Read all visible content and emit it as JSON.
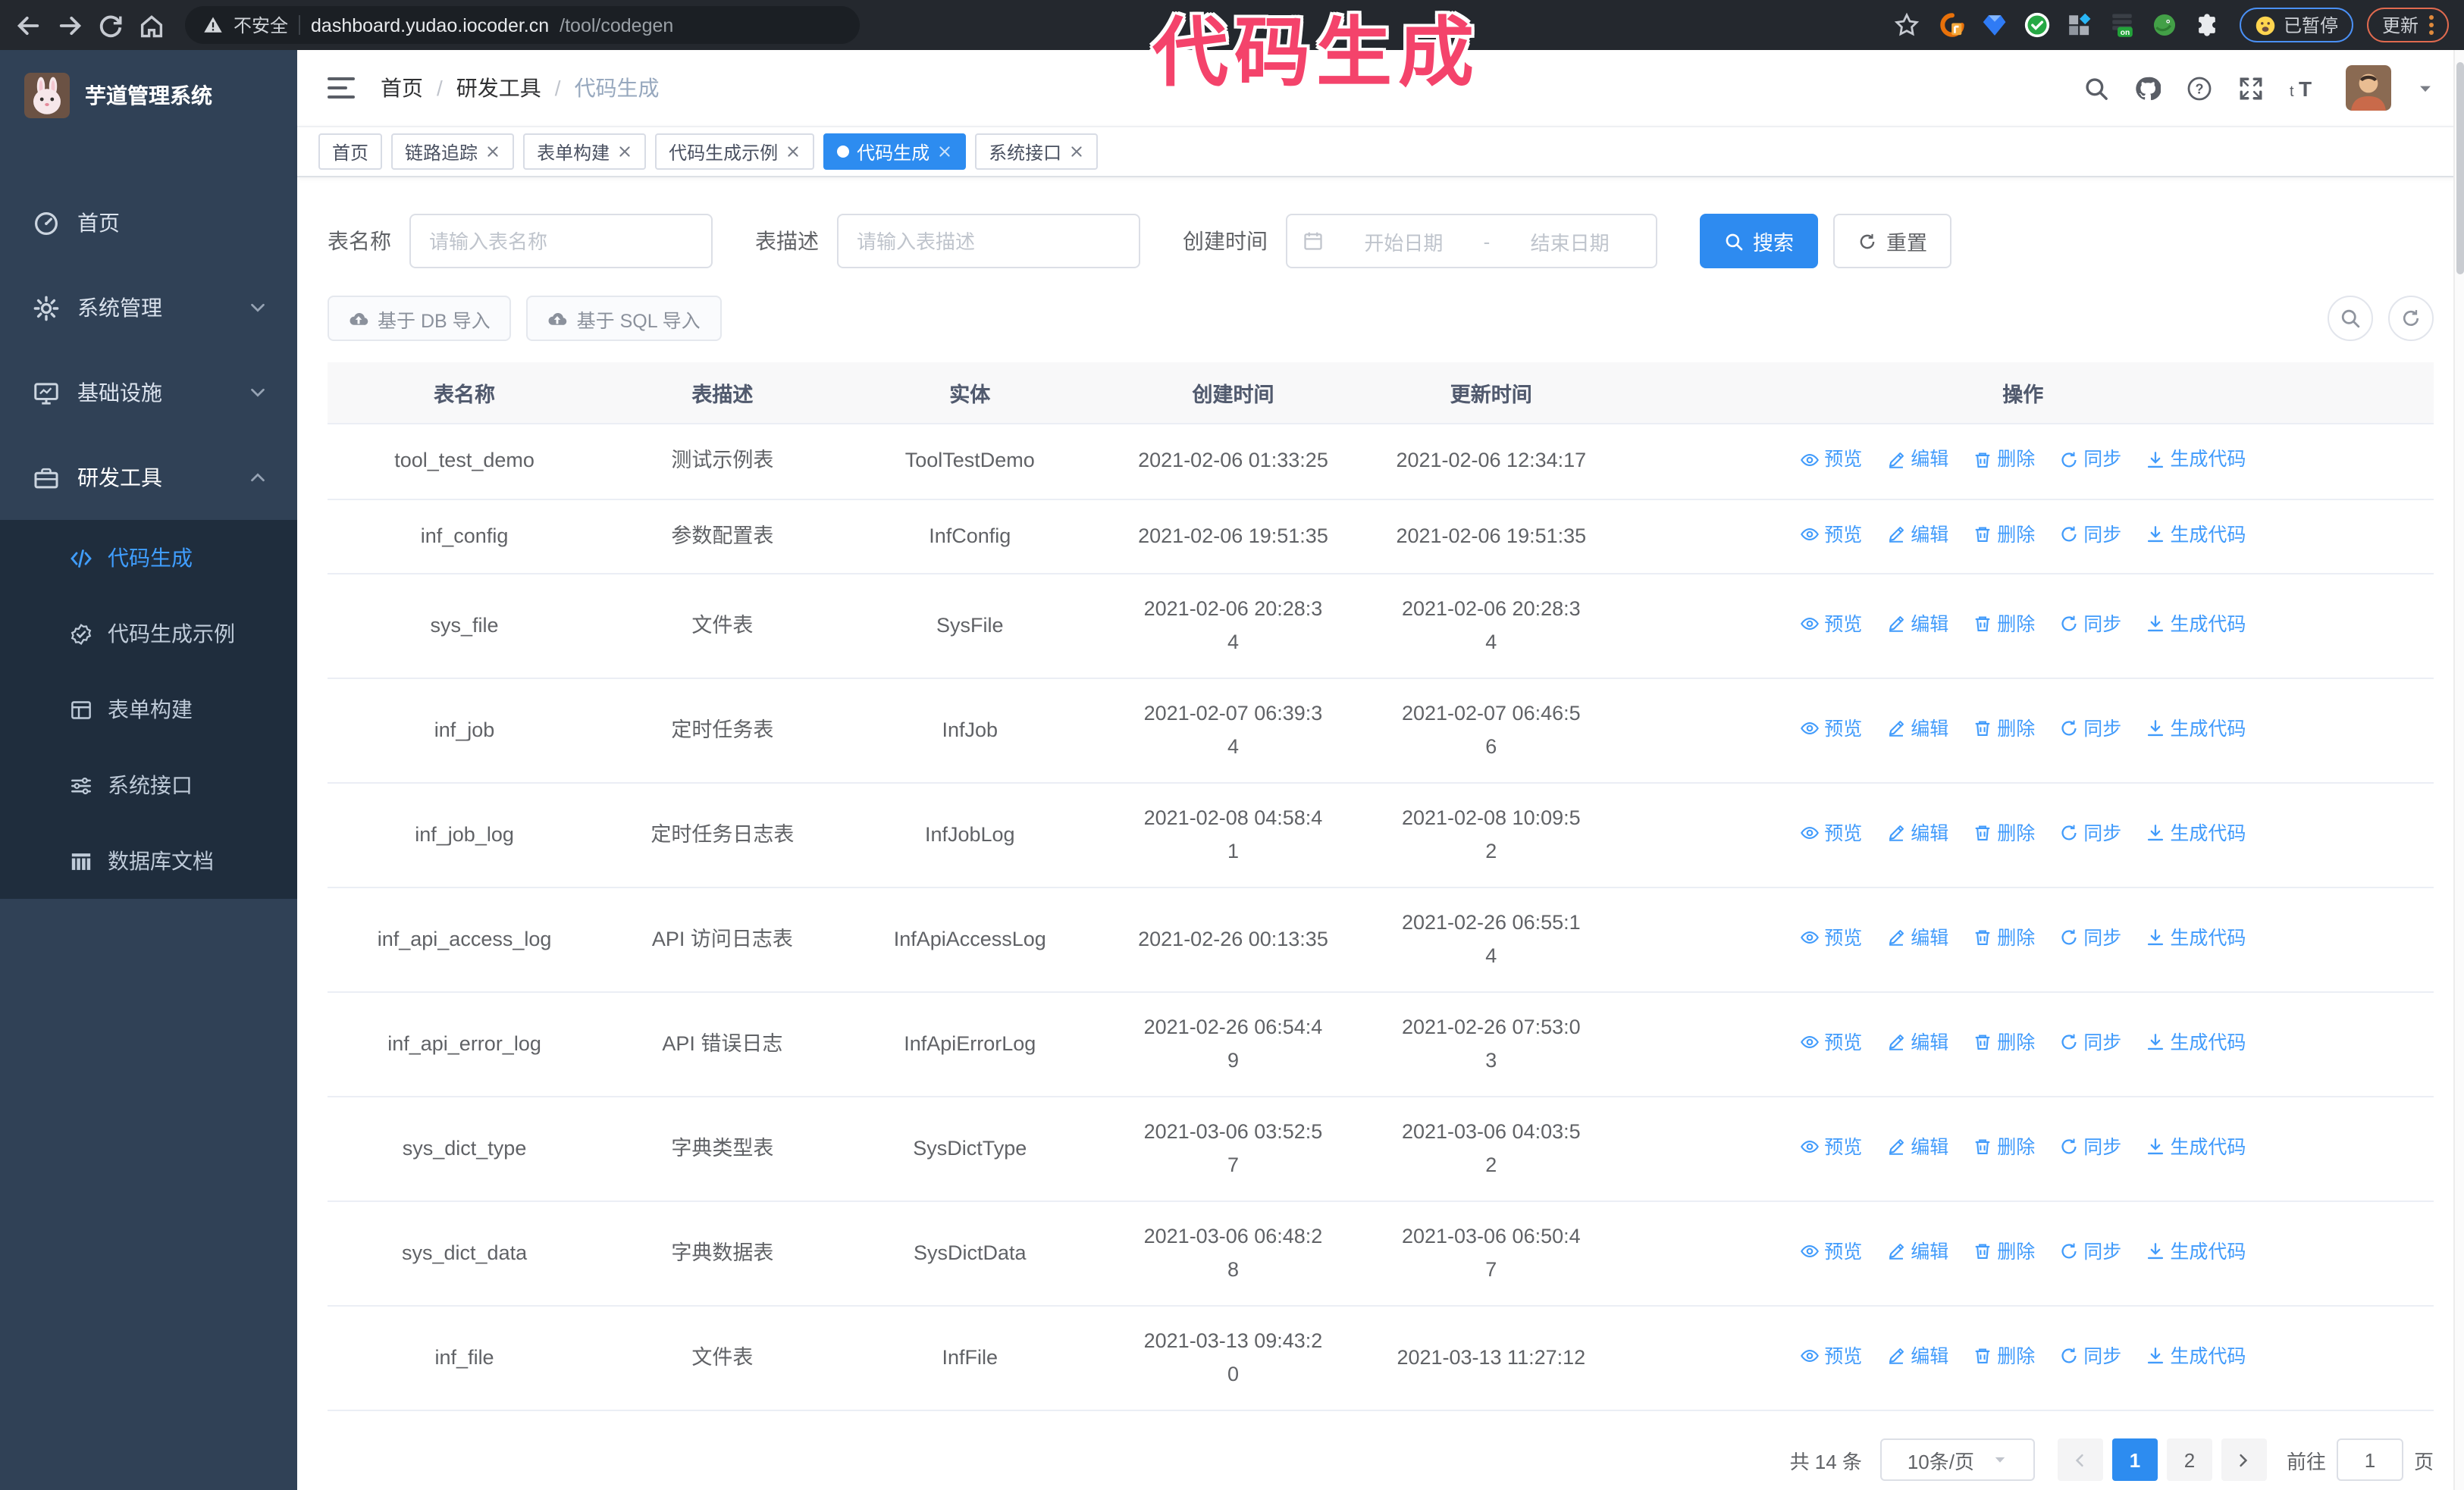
{
  "browser": {
    "security_warning": "不安全",
    "url_host": "dashboard.yudao.iocoder.cn",
    "url_path": "/tool/codegen",
    "extensions": [
      {
        "icon": "fehelper-icon"
      },
      {
        "icon": "gem-icon"
      },
      {
        "icon": "check-badge-icon"
      },
      {
        "icon": "grid-diamond-icon"
      },
      {
        "icon": "proxy-on-icon"
      },
      {
        "icon": "bird-icon"
      },
      {
        "icon": "puzzle-icon"
      }
    ],
    "paused_chip": "已暂停",
    "update_chip": "更新"
  },
  "overlay": {
    "text": "代码生成",
    "color": "#f4436b"
  },
  "sidebar": {
    "title": "芋道管理系统",
    "items": [
      {
        "label": "首页",
        "icon": "dashboard-icon",
        "chevron": ""
      },
      {
        "label": "系统管理",
        "icon": "gear-icon",
        "chevron": "chevron-down-icon"
      },
      {
        "label": "基础设施",
        "icon": "monitor-icon",
        "chevron": "chevron-down-icon"
      },
      {
        "label": "研发工具",
        "icon": "toolbox-icon",
        "chevron": "chevron-up-icon",
        "expanded": true
      }
    ],
    "submenu": [
      {
        "label": "代码生成",
        "icon": "code-icon",
        "active": true
      },
      {
        "label": "代码生成示例",
        "icon": "badge-check-icon"
      },
      {
        "label": "表单构建",
        "icon": "form-icon"
      },
      {
        "label": "系统接口",
        "icon": "sliders-icon"
      },
      {
        "label": "数据库文档",
        "icon": "database-doc-icon"
      }
    ]
  },
  "breadcrumb": {
    "separator": "/",
    "items": [
      "首页",
      "研发工具"
    ],
    "current": "代码生成"
  },
  "tags": [
    {
      "label": "首页",
      "closable": false
    },
    {
      "label": "链路追踪",
      "closable": true
    },
    {
      "label": "表单构建",
      "closable": true
    },
    {
      "label": "代码生成示例",
      "closable": true
    },
    {
      "label": "代码生成",
      "closable": true,
      "active": true
    },
    {
      "label": "系统接口",
      "closable": true
    }
  ],
  "filters": {
    "table_name_label": "表名称",
    "table_name_placeholder": "请输入表名称",
    "table_desc_label": "表描述",
    "table_desc_placeholder": "请输入表描述",
    "create_time_label": "创建时间",
    "date_start_placeholder": "开始日期",
    "date_separator": "-",
    "date_end_placeholder": "结束日期",
    "search_button": "搜索",
    "reset_button": "重置"
  },
  "toolbar": {
    "import_db_button": "基于 DB 导入",
    "import_sql_button": "基于 SQL 导入"
  },
  "table": {
    "columns": [
      "表名称",
      "表描述",
      "实体",
      "创建时间",
      "更新时间",
      "操作"
    ],
    "actions": [
      {
        "label": "预览",
        "icon": "eye-icon",
        "name": "preview"
      },
      {
        "label": "编辑",
        "icon": "edit-icon",
        "name": "edit"
      },
      {
        "label": "删除",
        "icon": "trash-icon",
        "name": "delete"
      },
      {
        "label": "同步",
        "icon": "sync-icon",
        "name": "sync"
      },
      {
        "label": "生成代码",
        "icon": "download-icon",
        "name": "generate-code"
      }
    ],
    "rows": [
      {
        "name": "tool_test_demo",
        "desc": "测试示例表",
        "entity": "ToolTestDemo",
        "created": "2021-02-06 01:33:25",
        "updated": "2021-02-06 12:34:17"
      },
      {
        "name": "inf_config",
        "desc": "参数配置表",
        "entity": "InfConfig",
        "created": "2021-02-06 19:51:35",
        "updated": "2021-02-06 19:51:35"
      },
      {
        "name": "sys_file",
        "desc": "文件表",
        "entity": "SysFile",
        "created": "2021-02-06 20:28:3\n4",
        "updated": "2021-02-06 20:28:3\n4"
      },
      {
        "name": "inf_job",
        "desc": "定时任务表",
        "entity": "InfJob",
        "created": "2021-02-07 06:39:3\n4",
        "updated": "2021-02-07 06:46:5\n6"
      },
      {
        "name": "inf_job_log",
        "desc": "定时任务日志表",
        "entity": "InfJobLog",
        "created": "2021-02-08 04:58:4\n1",
        "updated": "2021-02-08 10:09:5\n2"
      },
      {
        "name": "inf_api_access_log",
        "desc": "API 访问日志表",
        "entity": "InfApiAccessLog",
        "created": "2021-02-26 00:13:35",
        "updated": "2021-02-26 06:55:1\n4"
      },
      {
        "name": "inf_api_error_log",
        "desc": "API 错误日志",
        "entity": "InfApiErrorLog",
        "created": "2021-02-26 06:54:4\n9",
        "updated": "2021-02-26 07:53:0\n3"
      },
      {
        "name": "sys_dict_type",
        "desc": "字典类型表",
        "entity": "SysDictType",
        "created": "2021-03-06 03:52:5\n7",
        "updated": "2021-03-06 04:03:5\n2"
      },
      {
        "name": "sys_dict_data",
        "desc": "字典数据表",
        "entity": "SysDictData",
        "created": "2021-03-06 06:48:2\n8",
        "updated": "2021-03-06 06:50:4\n7"
      },
      {
        "name": "inf_file",
        "desc": "文件表",
        "entity": "InfFile",
        "created": "2021-03-13 09:43:2\n0",
        "updated": "2021-03-13 11:27:12"
      }
    ]
  },
  "pagination": {
    "total": "共 14 条",
    "page_size": "10条/页",
    "pages": [
      {
        "label": "1",
        "active": true
      },
      {
        "label": "2",
        "active": false
      }
    ],
    "goto_label": "前往",
    "goto_value": "1",
    "goto_suffix": "页"
  }
}
